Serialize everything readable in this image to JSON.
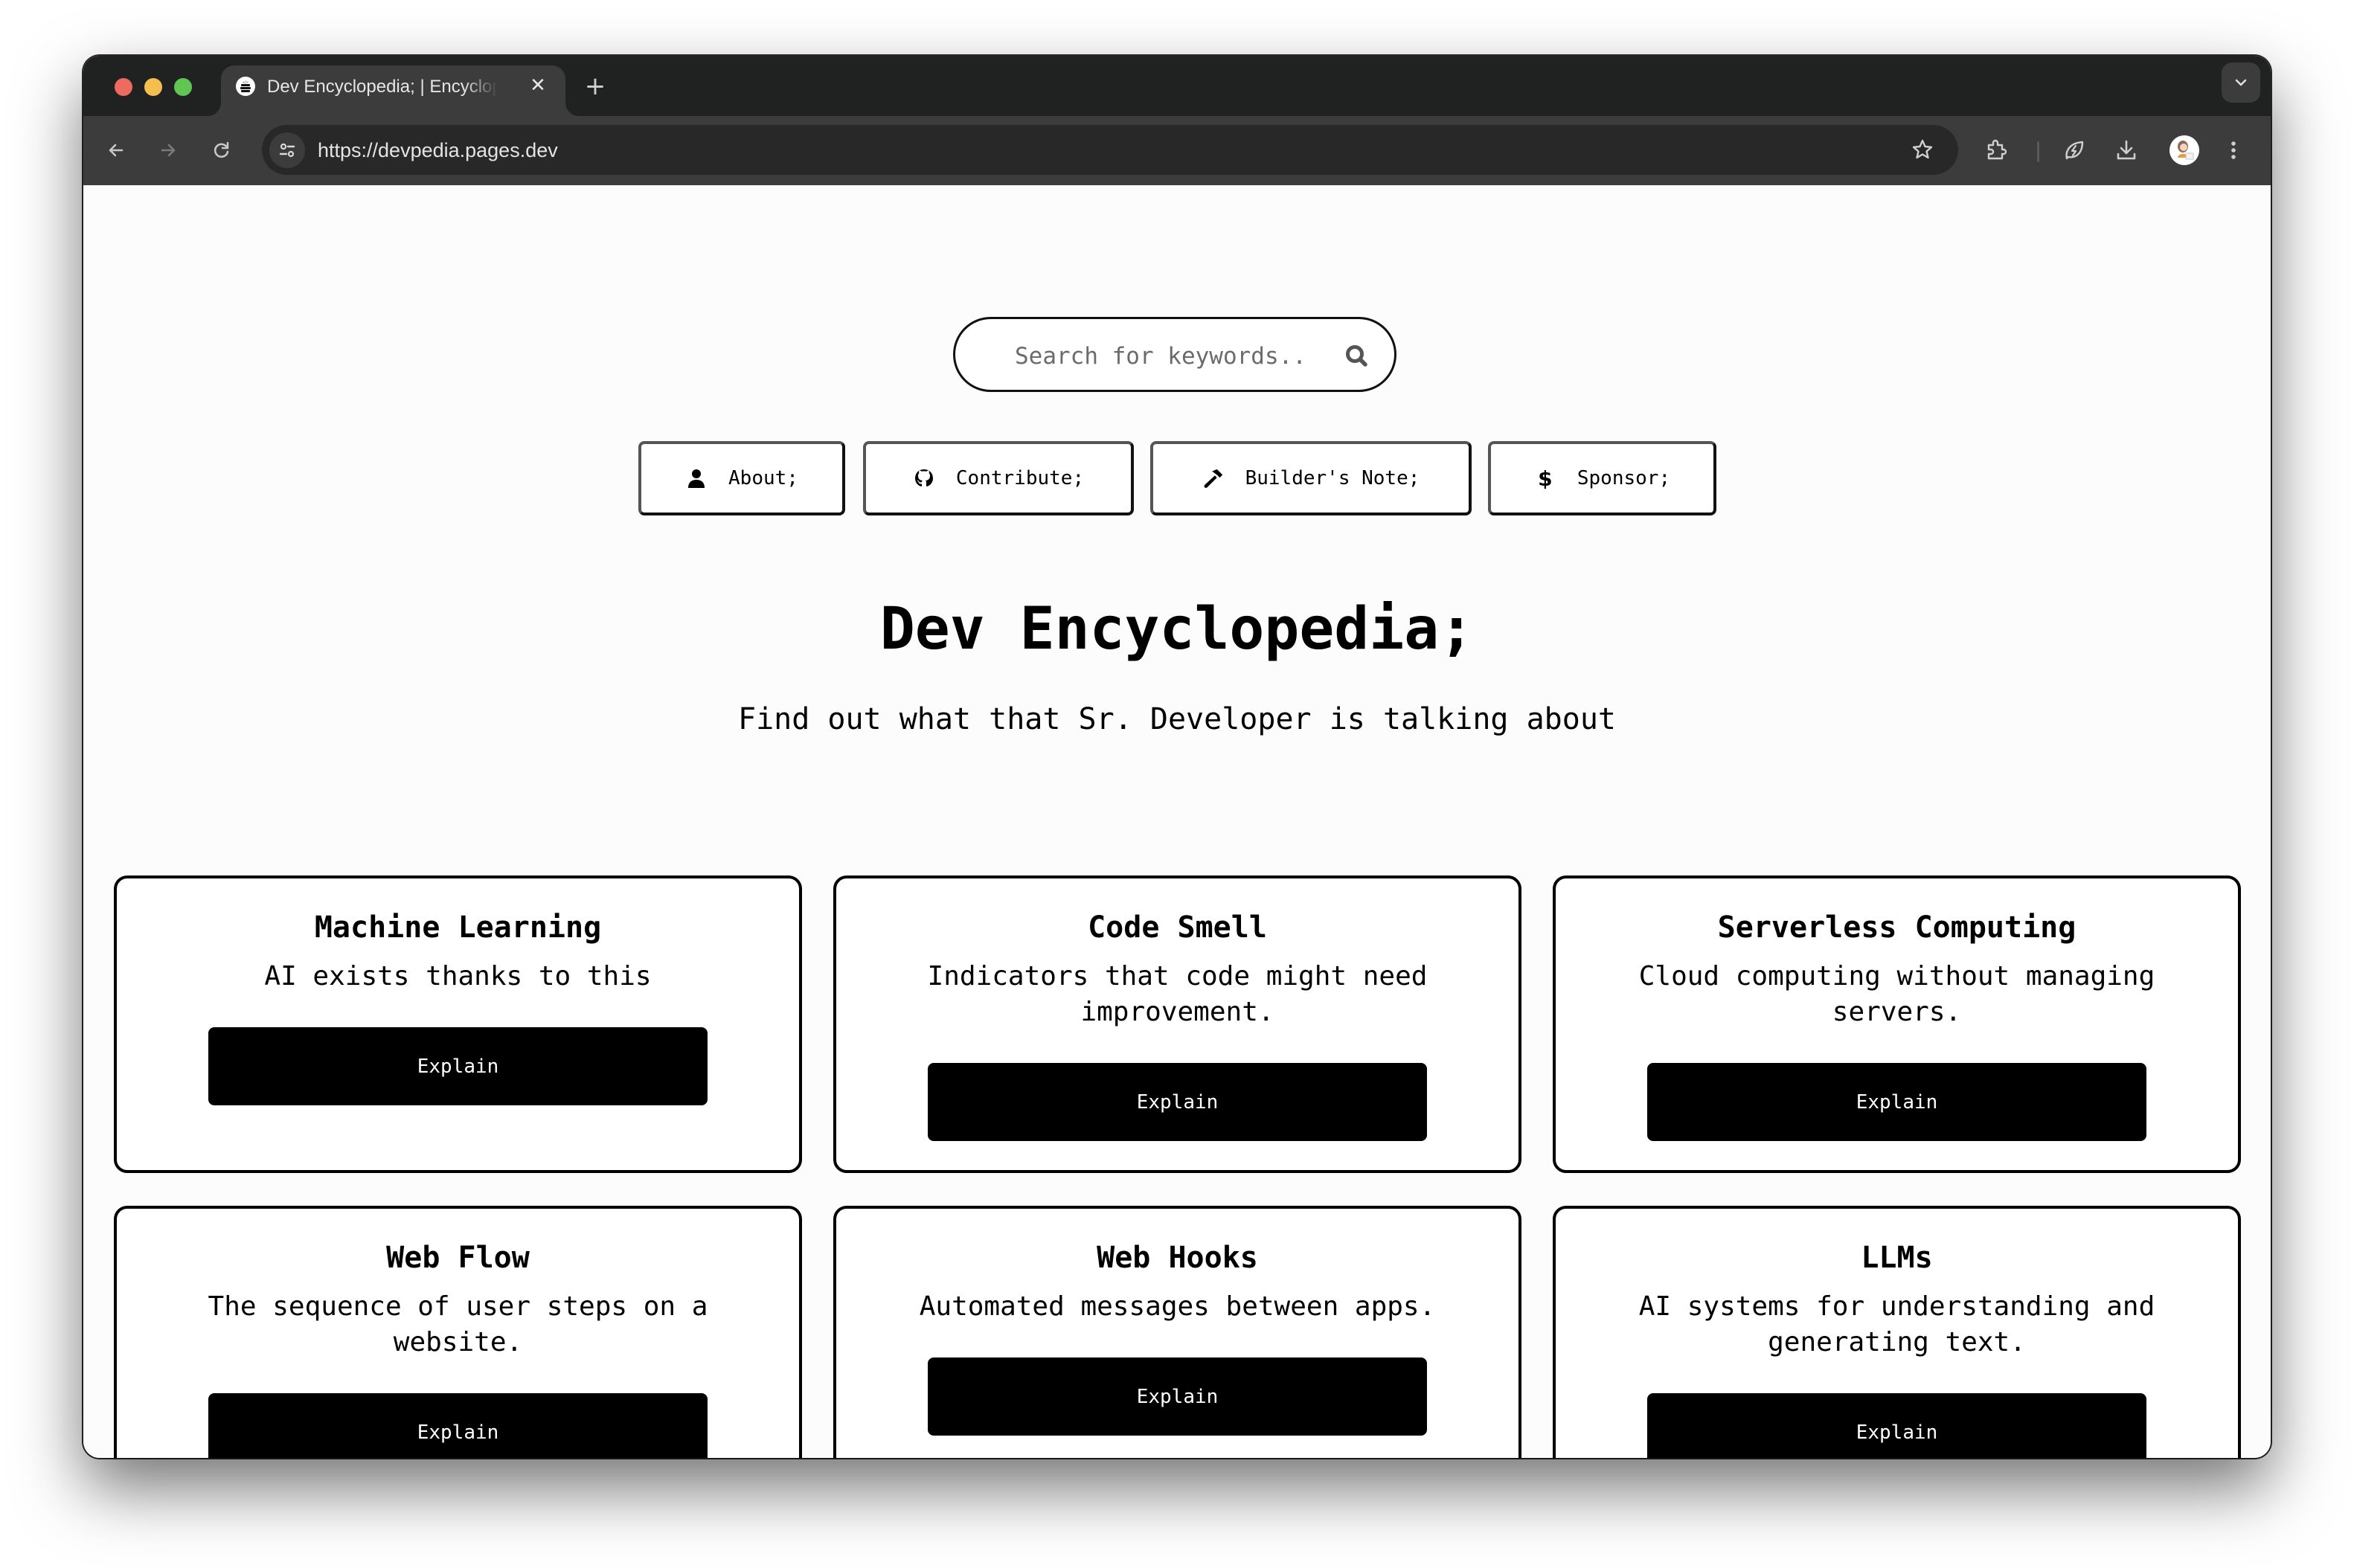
{
  "browser": {
    "tab": {
      "title": "Dev Encyclopedia; | Encyclopedia",
      "favicon": "book-stack-code-icon",
      "close_icon": "close-icon"
    },
    "new_tab_icon": "plus-icon",
    "tab_search_icon": "chevron-down-icon",
    "nav_icons": [
      "back-arrow-icon",
      "forward-arrow-icon",
      "reload-icon"
    ],
    "url": "https://devpedia.pages.dev",
    "site_info_icon": "tune-icon",
    "bookmark_icon": "star-icon",
    "toolbar_icons": [
      "extensions-puzzle-icon",
      "energy-leaf-icon",
      "download-icon",
      "profile-avatar",
      "more-vertical-icon"
    ]
  },
  "search": {
    "placeholder": "Search for keywords..",
    "value": "",
    "icon": "search-icon"
  },
  "nav": [
    {
      "label": "About;",
      "icon": "user-icon"
    },
    {
      "label": "Contribute;",
      "icon": "github-icon"
    },
    {
      "label": "Builder's Note;",
      "icon": "hammer-icon"
    },
    {
      "label": "Sponsor;",
      "icon": "dollar-icon"
    }
  ],
  "hero": {
    "title": "Dev Encyclopedia;",
    "subtitle": "Find out what that Sr. Developer is talking about"
  },
  "cards": [
    {
      "title": "Machine Learning",
      "description": "AI exists thanks to this",
      "button": "Explain"
    },
    {
      "title": "Code Smell",
      "description": "Indicators that code might need improvement.",
      "button": "Explain"
    },
    {
      "title": "Serverless Computing",
      "description": "Cloud computing without managing servers.",
      "button": "Explain"
    },
    {
      "title": "Web Flow",
      "description": "The sequence of user steps on a website.",
      "button": "Explain"
    },
    {
      "title": "Web Hooks",
      "description": "Automated messages between apps.",
      "button": "Explain"
    },
    {
      "title": "LLMs",
      "description": "AI systems for understanding and generating text.",
      "button": "Explain"
    }
  ],
  "colors": {
    "page_background": "#fcfcfc",
    "card_background": "#ffffff",
    "primary": "#000000",
    "button_text": "#ffffff",
    "placeholder": "#6b6b6b",
    "browser_frame": "#202221",
    "browser_toolbar": "#3c3c3c"
  }
}
